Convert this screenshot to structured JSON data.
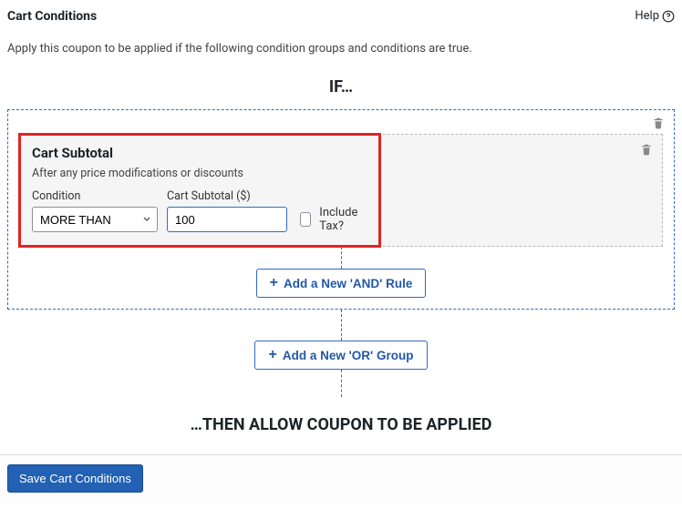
{
  "header": {
    "title": "Cart Conditions",
    "help": "Help"
  },
  "subtitle": "Apply this coupon to be applied if the following condition groups and conditions are true.",
  "if_label": "IF…",
  "rule": {
    "title": "Cart Subtotal",
    "desc": "After any price modifications or discounts",
    "condition_label": "Condition",
    "condition_value": "MORE THAN",
    "subtotal_label": "Cart Subtotal ($)",
    "subtotal_value": "100",
    "include_tax_label": "Include Tax?"
  },
  "buttons": {
    "add_and": "Add a New 'AND' Rule",
    "add_or": "Add a New 'OR' Group",
    "save": "Save Cart Conditions"
  },
  "then_label": "…THEN ALLOW COUPON TO BE APPLIED"
}
